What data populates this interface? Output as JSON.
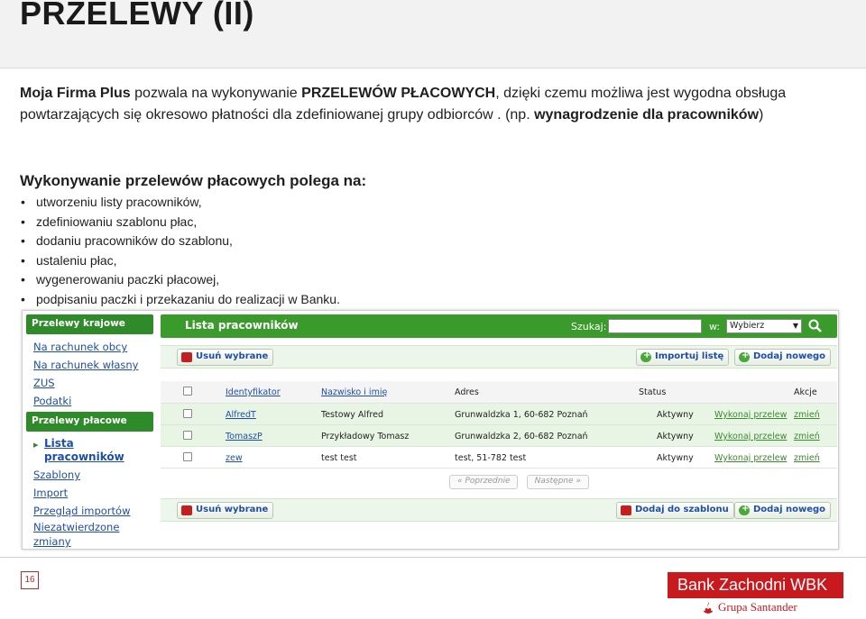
{
  "slide": {
    "title": "PRZELEWY (II)",
    "intro": {
      "brand": "Moja Firma Plus",
      "t1": " pozwala na wykonywanie ",
      "feature": "PRZELEWÓW PŁACOWYCH",
      "t2": ", dzięki czemu możliwa jest wygodna obsługa powtarzających się okresowo płatności dla zdefiniowanej grupy odbiorców . (np. ",
      "example": "wynagrodzenie dla pracowników",
      "t3": ")"
    },
    "steps_heading": "Wykonywanie przelewów płacowych polega na:",
    "steps": [
      "utworzeniu listy pracowników,",
      "zdefiniowaniu szablonu płac,",
      "dodaniu pracowników do szablonu,",
      "ustaleniu płac,",
      "wygenerowaniu paczki płacowej,",
      "podpisaniu paczki i przekazaniu do realizacji w Banku."
    ],
    "page_number": "16"
  },
  "app": {
    "nav": {
      "section1": "Przelewy krajowe",
      "links1": [
        "Na rachunek obcy",
        "Na rachunek własny",
        "ZUS",
        "Podatki"
      ],
      "section2": "Przelewy płacowe",
      "active_line1": "Lista",
      "active_line2": "pracowników",
      "links2": [
        "Szablony",
        "Import",
        "Przegląd importów",
        "Niezatwierdzone",
        "zmiany"
      ]
    },
    "main": {
      "title": "Lista pracowników",
      "search_label": "Szukaj:",
      "search_value": "",
      "w_label": "w:",
      "select_value": "Wybierz",
      "btn_delete": "Usuń wybrane",
      "btn_import": "Importuj listę",
      "btn_add_new": "Dodaj nowego",
      "btn_add_template": "Dodaj do szablonu",
      "columns": {
        "id": "Identyfikator",
        "name": "Nazwisko i imię",
        "address": "Adres",
        "status": "Status",
        "actions": "Akcje"
      },
      "rows": [
        {
          "id": "AlfredT",
          "name": "Testowy Alfred",
          "address": "Grunwaldzka 1, 60-682 Poznań",
          "status": "Aktywny",
          "action": "Wykonaj przelew",
          "edit": "zmień"
        },
        {
          "id": "TomaszP",
          "name": "Przykładowy Tomasz",
          "address": "Grunwaldzka 2, 60-682 Poznań",
          "status": "Aktywny",
          "action": "Wykonaj przelew",
          "edit": "zmień"
        },
        {
          "id": "zew",
          "name": "test test",
          "address": "test, 51-782 test",
          "status": "Aktywny",
          "action": "Wykonaj przelew",
          "edit": "zmień"
        }
      ],
      "prev": "« Poprzednie",
      "next": "Następne »"
    }
  },
  "bank": {
    "name": "Bank Zachodni WBK",
    "group": "Grupa Santander"
  },
  "colors": {
    "nav_green": "#2f8a2a",
    "header_green": "#3a9a2c",
    "link_blue": "#1e4fa8",
    "bank_red": "#c8191f"
  }
}
